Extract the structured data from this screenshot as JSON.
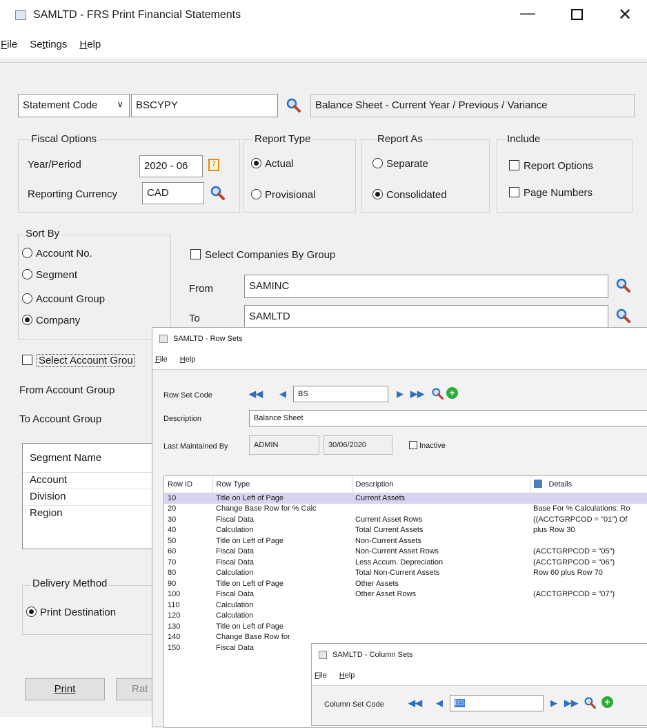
{
  "main": {
    "title": "SAMLTD - FRS Print Financial Statements",
    "menu": [
      "File",
      "Settings",
      "Help"
    ],
    "statement_code_label": "Statement Code",
    "statement_code_value": "BSCYPY",
    "statement_desc": "Balance Sheet - Current Year / Previous / Variance",
    "fiscal_options_label": "Fiscal Options",
    "year_period_label": "Year/Period",
    "year_period_value": "2020 - 06",
    "reporting_currency_label": "Reporting Currency",
    "reporting_currency_value": "CAD",
    "report_type_label": "Report Type",
    "report_type_options": [
      "Actual",
      "Provisional"
    ],
    "report_as_label": "Report As",
    "report_as_options": [
      "Separate",
      "Consolidated"
    ],
    "include_label": "Include",
    "include_options": [
      "Report Options",
      "Page Numbers"
    ],
    "sort_by_label": "Sort By",
    "sort_by_options": [
      "Account No.",
      "Segment",
      "Account Group",
      "Company"
    ],
    "select_companies_label": "Select Companies By Group",
    "from_label": "From",
    "from_value": "SAMINC",
    "to_label": "To",
    "to_value": "SAMLTD",
    "select_account_group_label": "Select Account Grou",
    "from_account_group_label": "From Account Group",
    "to_account_group_label": "To Account Group",
    "segment_name_header": "Segment Name",
    "segments": [
      "Account",
      "Division",
      "Region"
    ],
    "delivery_method_label": "Delivery Method",
    "print_destination_label": "Print Destination",
    "print_button": "Print",
    "second_button": "Rat"
  },
  "rowsets": {
    "title": "SAMLTD - Row Sets",
    "menu": [
      "File",
      "Help"
    ],
    "row_set_code_label": "Row Set Code",
    "row_set_code_value": "BS",
    "description_label": "Description",
    "description_value": "Balance Sheet",
    "last_maintained_label": "Last Maintained By",
    "last_maintained_user": "ADMIN",
    "last_maintained_date": "30/06/2020",
    "inactive_label": "Inactive",
    "columns": [
      "Row ID",
      "Row Type",
      "Description",
      "Details"
    ],
    "rows": [
      [
        "10",
        "Title on Left of Page",
        "Current Assets",
        ""
      ],
      [
        "20",
        "Change Base Row for % Calc",
        "",
        "Base For % Calculations: Ro"
      ],
      [
        "30",
        "Fiscal Data",
        "Current Asset Rows",
        "((ACCTGRPCOD = \"01\") Of"
      ],
      [
        "40",
        "Calculation",
        "Total Current Assets",
        "plus Row 30"
      ],
      [
        "50",
        "Title on Left of Page",
        "Non-Current Assets",
        ""
      ],
      [
        "60",
        "Fiscal Data",
        "Non-Current Asset Rows",
        "(ACCTGRPCOD = \"05\")"
      ],
      [
        "70",
        "Fiscal Data",
        "Less Accum. Depreciation",
        "(ACCTGRPCOD = \"06\")"
      ],
      [
        "80",
        "Calculation",
        "Total Non-Current Assets",
        "Row 60 plus Row 70"
      ],
      [
        "90",
        "Title on Left of Page",
        "Other Assets",
        ""
      ],
      [
        "100",
        "Fiscal Data",
        "Other Asset Rows",
        "(ACCTGRPCOD = \"07\")"
      ],
      [
        "110",
        "Calculation",
        "",
        ""
      ],
      [
        "120",
        "Calculation",
        "",
        ""
      ],
      [
        "130",
        "Title on Left of Page",
        "",
        ""
      ],
      [
        "140",
        "Change Base Row for",
        "",
        ""
      ],
      [
        "150",
        "Fiscal Data",
        "",
        ""
      ]
    ]
  },
  "colsets": {
    "title": "SAMLTD - Column Sets",
    "menu": [
      "File",
      "Help"
    ],
    "column_set_code_label": "Column Set Code",
    "column_set_code_value": "BS"
  },
  "colors": {
    "selected_row": "#d9d3f2",
    "green_add": "#2eaa3c",
    "magnifier_blue": "#2f6fbf"
  }
}
